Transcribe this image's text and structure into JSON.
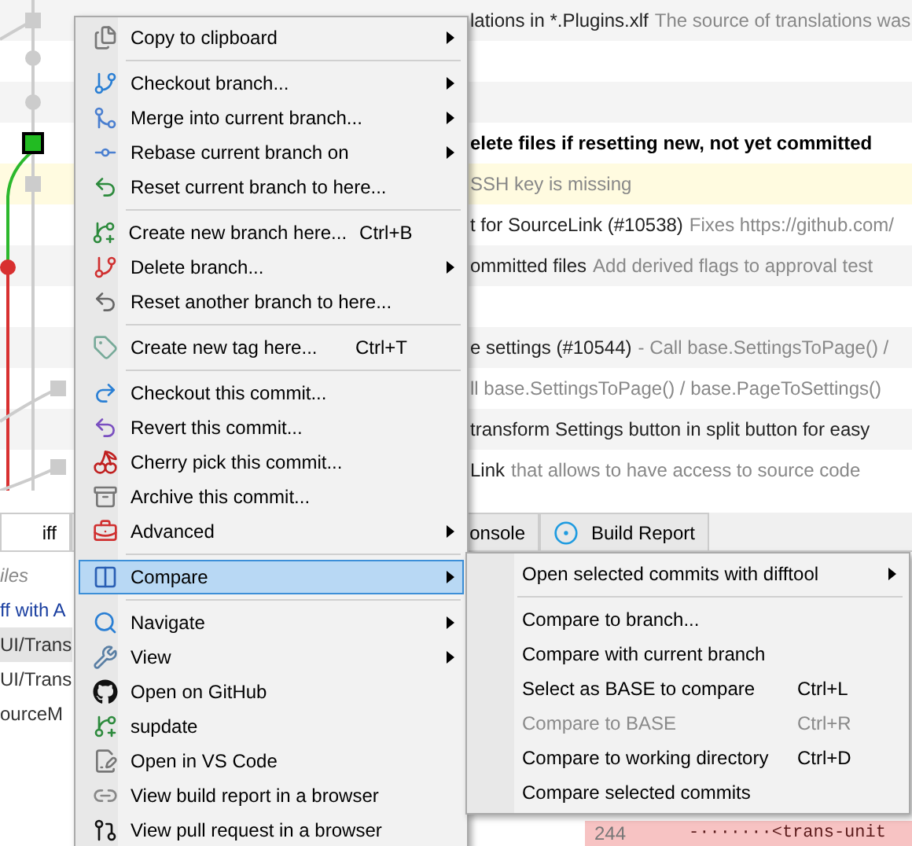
{
  "commits": [
    {
      "subject": "lations in *.Plugins.xlf",
      "body": "The source of translations was",
      "bold": false,
      "highlight": false
    },
    {
      "highlight": false
    },
    {
      "highlight": false
    },
    {
      "subject": "elete files if resetting new, not yet committed",
      "bold": true,
      "highlight": false
    },
    {
      "body": "SSH key is missing",
      "highlight": true
    },
    {
      "subject": "t for SourceLink (#10538)",
      "body": "Fixes https://github.com/",
      "bold": false,
      "highlight": false
    },
    {
      "subject": "ommitted files",
      "body": "Add derived flags to approval test",
      "bold": false,
      "highlight": false
    },
    {
      "highlight": false
    },
    {
      "subject": "e settings (#10544)",
      "body": "- Call base.SettingsToPage() /",
      "bold": false,
      "highlight": false
    },
    {
      "body": "ll base.SettingsToPage() / base.PageToSettings()",
      "highlight": false
    },
    {
      "subject": "transform Settings button in split button for easy",
      "bold": false,
      "highlight": false
    },
    {
      "subject": "Link",
      "body": "that allows to have access to source code",
      "bold": false,
      "highlight": false
    }
  ],
  "tabs": [
    {
      "kind": "text",
      "label": "iff",
      "selected": true
    },
    {
      "kind": "icon",
      "selected": false
    },
    {
      "kind": "text",
      "label": "onsole",
      "selected": false
    },
    {
      "kind": "text",
      "label": "Build Report",
      "selected": false
    }
  ],
  "files": [
    {
      "name": "iles",
      "kind": "note",
      "selected": false
    },
    {
      "name": "ff with A",
      "kind": "link",
      "selected": false
    },
    {
      "name": "UI/Trans",
      "kind": "file",
      "selected": true
    },
    {
      "name": "UI/Trans",
      "kind": "file",
      "selected": false
    },
    {
      "name": "ourceM",
      "kind": "file",
      "selected": false
    }
  ],
  "diff": {
    "line_number": "244",
    "text": "-·······<trans-unit"
  },
  "context_menu": {
    "groups": [
      [
        {
          "label": "Copy to clipboard",
          "submenu": true,
          "selected": false
        }
      ],
      [
        {
          "label": "Checkout branch...",
          "submenu": true,
          "selected": false
        },
        {
          "label": "Merge into current branch...",
          "submenu": true,
          "selected": false
        },
        {
          "label": "Rebase current branch on",
          "submenu": true,
          "selected": false
        },
        {
          "label": "Reset current branch to here...",
          "submenu": false,
          "selected": false
        }
      ],
      [
        {
          "label": "Create new branch here...",
          "shortcut": "Ctrl+B",
          "submenu": false,
          "selected": false
        },
        {
          "label": "Delete branch...",
          "submenu": true,
          "selected": false
        },
        {
          "label": "Reset another branch to here...",
          "submenu": false,
          "selected": false
        }
      ],
      [
        {
          "label": "Create new tag here...",
          "shortcut": "Ctrl+T",
          "submenu": false,
          "selected": false
        }
      ],
      [
        {
          "label": "Checkout this commit...",
          "submenu": false,
          "selected": false
        },
        {
          "label": "Revert this commit...",
          "submenu": false,
          "selected": false
        },
        {
          "label": "Cherry pick this commit...",
          "submenu": false,
          "selected": false
        },
        {
          "label": "Archive this commit...",
          "submenu": false,
          "selected": false
        },
        {
          "label": "Advanced",
          "submenu": true,
          "selected": false
        }
      ],
      [
        {
          "label": "Compare",
          "submenu": true,
          "selected": true
        }
      ],
      [
        {
          "label": "Navigate",
          "submenu": true,
          "selected": false
        },
        {
          "label": "View",
          "submenu": true,
          "selected": false
        },
        {
          "label": "Open on GitHub",
          "submenu": false,
          "selected": false
        },
        {
          "label": "supdate",
          "submenu": false,
          "selected": false
        },
        {
          "label": "Open in VS Code",
          "submenu": false,
          "selected": false
        },
        {
          "label": "View build report in a browser",
          "submenu": false,
          "selected": false
        },
        {
          "label": "View pull request in a browser",
          "submenu": false,
          "selected": false
        }
      ]
    ]
  },
  "compare_submenu": {
    "groups": [
      [
        {
          "label": "Open selected commits with difftool",
          "submenu": true,
          "disabled": false
        }
      ],
      [
        {
          "label": "Compare to branch...",
          "submenu": false,
          "disabled": false
        },
        {
          "label": "Compare with current branch",
          "submenu": false,
          "disabled": false
        },
        {
          "label": "Select as BASE to compare",
          "shortcut": "Ctrl+L",
          "submenu": false,
          "disabled": false
        },
        {
          "label": "Compare to BASE",
          "shortcut": "Ctrl+R",
          "submenu": false,
          "disabled": true
        },
        {
          "label": "Compare to working directory",
          "shortcut": "Ctrl+D",
          "submenu": false,
          "disabled": false
        },
        {
          "label": "Compare selected commits",
          "submenu": false,
          "disabled": false
        }
      ]
    ]
  }
}
